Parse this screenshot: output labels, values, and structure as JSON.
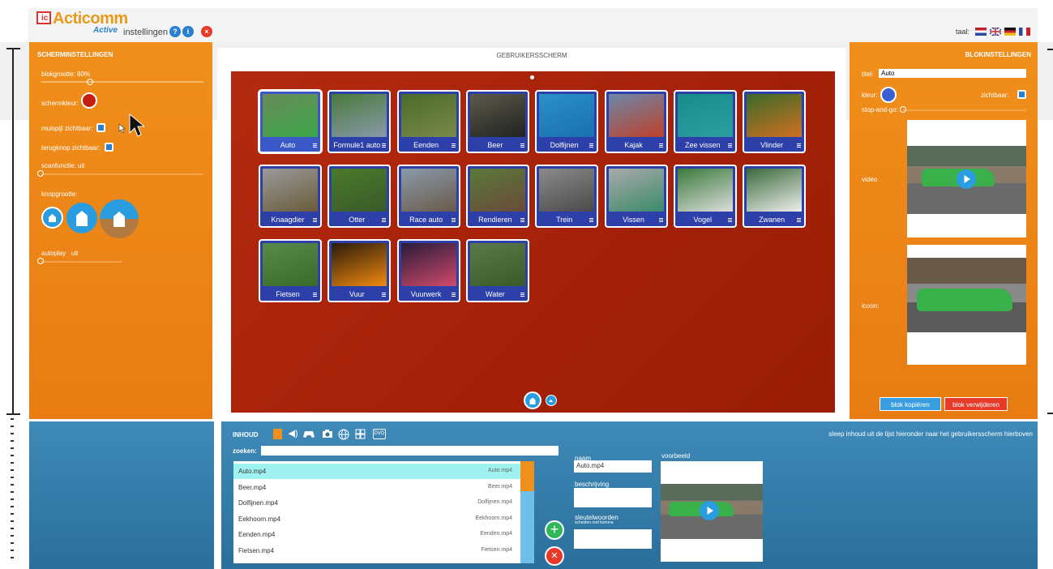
{
  "top": {
    "logo_text": "Acticomm",
    "logo_sub": "Active",
    "settings_label": "instellingen",
    "lang_label": "taal:"
  },
  "left_panel": {
    "title": "SCHERMINSTELLINGEN",
    "block_size_label": "blokgrootte:",
    "block_size_value": "80%",
    "block_size_fraction": 0.3,
    "screen_color_label": "schermkleur:",
    "screen_color": "#c41f10",
    "pointer_visible_label": "muispijl zichtbaar:",
    "back_button_visible_label": "terugknop zichtbaar:",
    "scan_label": "scanfunctie:",
    "scan_value": "uit",
    "button_size_label": "knopgrootte:",
    "autoplay_label": "autoplay",
    "autoplay_value": "uit"
  },
  "center": {
    "title": "GEBRUIKERSSCHERM",
    "tiles": [
      {
        "label": "Auto",
        "thumb": [
          "#6a8a5a",
          "#3aa84a"
        ]
      },
      {
        "label": "Formule1 auto",
        "thumb": [
          "#4a7a3a",
          "#8899aa"
        ]
      },
      {
        "label": "Eenden",
        "thumb": [
          "#4a6a2a",
          "#7a8a4a"
        ]
      },
      {
        "label": "Beer",
        "thumb": [
          "#5a5a4a",
          "#222222"
        ]
      },
      {
        "label": "Dolfijnen",
        "thumb": [
          "#2a90c8",
          "#1a70b0"
        ]
      },
      {
        "label": "Kajak",
        "thumb": [
          "#6a88a8",
          "#c0402a"
        ]
      },
      {
        "label": "Zee vissen",
        "thumb": [
          "#1a8a8a",
          "#2aa0a0"
        ]
      },
      {
        "label": "Vlinder",
        "thumb": [
          "#3a6a2a",
          "#d07020"
        ]
      },
      {
        "label": "Knaagdier",
        "thumb": [
          "#9a9a9a",
          "#6a5a3a"
        ]
      },
      {
        "label": "Otter",
        "thumb": [
          "#4a7a2a",
          "#3a5a2a"
        ]
      },
      {
        "label": "Race auto",
        "thumb": [
          "#8a9aaa",
          "#6a5a4a"
        ]
      },
      {
        "label": "Rendieren",
        "thumb": [
          "#5a7a3a",
          "#6a4a3a"
        ]
      },
      {
        "label": "Trein",
        "thumb": [
          "#8a8a8a",
          "#4a4a4a"
        ]
      },
      {
        "label": "Vissen",
        "thumb": [
          "#aaaaaa",
          "#3a8a6a"
        ]
      },
      {
        "label": "Vogel",
        "thumb": [
          "#3a7a3a",
          "#dddddd"
        ]
      },
      {
        "label": "Zwanen",
        "thumb": [
          "#3a6a3a",
          "#eeeeee"
        ]
      },
      {
        "label": "Fietsen",
        "thumb": [
          "#5a8a4a",
          "#3a6a2a"
        ]
      },
      {
        "label": "Vuur",
        "thumb": [
          "#2a1a0a",
          "#f08a10"
        ]
      },
      {
        "label": "Vuurwerk",
        "thumb": [
          "#2a1a3a",
          "#d04a6a"
        ]
      },
      {
        "label": "Water",
        "thumb": [
          "#5a7a4a",
          "#3a5a2a"
        ]
      }
    ]
  },
  "right_panel": {
    "title": "BLOKINSTELLINGEN",
    "title_label": "titel:",
    "title_value": "Auto",
    "color_label": "kleur:",
    "color": "#3a5fd0",
    "visible_label": "zichtbaar:",
    "stop_and_go_label": "stop-and-go:",
    "video_label": "video",
    "icon_label": "icoon:",
    "copy_button": "blok kopiëren",
    "delete_button": "blok verwijderen"
  },
  "bottom": {
    "content_label": "INHOUD",
    "drag_hint": "sleep inhoud uit de lijst hieronder naar het gebruikersscherm hierboven",
    "search_label": "zoeken:",
    "files": [
      {
        "name": "Auto.mp4",
        "file": "Auto.mp4"
      },
      {
        "name": "Beer.mp4",
        "file": "Beer.mp4"
      },
      {
        "name": "Dolfijnen.mp4",
        "file": "Dolfijnen.mp4"
      },
      {
        "name": "Eekhoorn.mp4",
        "file": "Eekhoorn.mp4"
      },
      {
        "name": "Eenden.mp4",
        "file": "Eenden.mp4"
      },
      {
        "name": "Fietsen.mp4",
        "file": "Fietsen.mp4"
      }
    ],
    "name_label": "naam",
    "name_value": "Auto.mp4",
    "description_label": "beschrijving",
    "keywords_label": "sleutelwoorden",
    "keywords_hint": "scheiden met komma",
    "preview_label": "voorbeeld",
    "dvd_label": "DVD"
  }
}
